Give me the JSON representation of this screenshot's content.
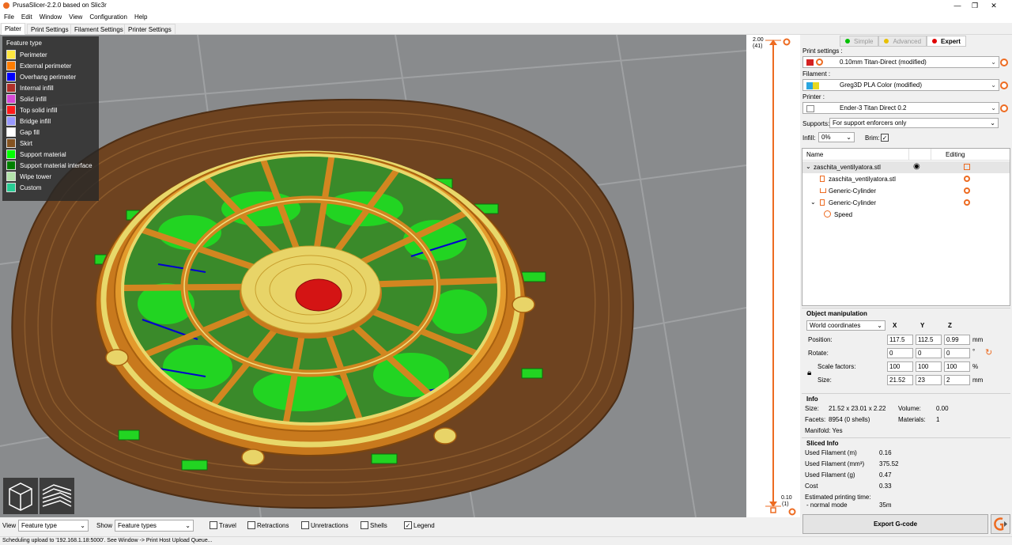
{
  "window": {
    "title": "PrusaSlicer-2.2.0 based on Slic3r",
    "minimize": "—",
    "restore": "❐",
    "close": "✕"
  },
  "menu": [
    "File",
    "Edit",
    "Window",
    "View",
    "Configuration",
    "Help"
  ],
  "tabs": [
    "Plater",
    "Print Settings",
    "Filament Settings",
    "Printer Settings"
  ],
  "active_tab": "Plater",
  "legend": {
    "title": "Feature type",
    "items": [
      {
        "label": "Perimeter",
        "color": "#ffe640"
      },
      {
        "label": "External perimeter",
        "color": "#ff7d00"
      },
      {
        "label": "Overhang perimeter",
        "color": "#0000ff"
      },
      {
        "label": "Internal infill",
        "color": "#b03029"
      },
      {
        "label": "Solid infill",
        "color": "#d64ad6"
      },
      {
        "label": "Top solid infill",
        "color": "#ff1a1a"
      },
      {
        "label": "Bridge infill",
        "color": "#9999ff"
      },
      {
        "label": "Gap fill",
        "color": "#ffffff"
      },
      {
        "label": "Skirt",
        "color": "#845321"
      },
      {
        "label": "Support material",
        "color": "#00ff00"
      },
      {
        "label": "Support material interface",
        "color": "#008000"
      },
      {
        "label": "Wipe tower",
        "color": "#b3e3ab"
      },
      {
        "label": "Custom",
        "color": "#28cc94"
      }
    ]
  },
  "layer_slider": {
    "top_value": "2.00",
    "top_layer": "(41)",
    "bottom_value": "0.10",
    "bottom_layer": "(1)"
  },
  "modes": [
    {
      "label": "Simple",
      "color": "#00c000",
      "active": false
    },
    {
      "label": "Advanced",
      "color": "#e8c000",
      "active": false
    },
    {
      "label": "Expert",
      "color": "#e00000",
      "active": true
    }
  ],
  "print_settings": {
    "label": "Print settings :",
    "value": "0.10mm Titan-Direct (modified)"
  },
  "filament": {
    "label": "Filament :",
    "value": "Greg3D PLA Color (modified)"
  },
  "printer": {
    "label": "Printer :",
    "value": "Ender-3 Titan Direct 0.2"
  },
  "supports": {
    "label": "Supports:",
    "value": "For support enforcers only"
  },
  "infill": {
    "label": "Infill:",
    "value": "0%"
  },
  "brim": {
    "label": "Brim:",
    "checked": "✓"
  },
  "object_list": {
    "col_name": "Name",
    "col_editing": "Editing",
    "rows": [
      {
        "name": "zaschita_ventilyatora.stl",
        "expander": "⌄",
        "selected": true
      },
      {
        "name": "zaschita_ventilyatora.stl"
      },
      {
        "name": "Generic-Cylinder"
      },
      {
        "name": "Generic-Cylinder",
        "expander": "⌄"
      },
      {
        "name": "Speed"
      }
    ]
  },
  "object_manipulation": {
    "title": "Object manipulation",
    "coord_system": "World coordinates",
    "axes": [
      "X",
      "Y",
      "Z"
    ],
    "position": {
      "label": "Position:",
      "values": [
        "117.5",
        "112.5",
        "0.99"
      ],
      "unit": "mm"
    },
    "rotate": {
      "label": "Rotate:",
      "values": [
        "0",
        "0",
        "0"
      ],
      "unit": "°"
    },
    "scale": {
      "label": "Scale factors:",
      "values": [
        "100",
        "100",
        "100"
      ],
      "unit": "%"
    },
    "size": {
      "label": "Size:",
      "values": [
        "21.52",
        "23",
        "2"
      ],
      "unit": "mm"
    }
  },
  "info": {
    "title": "Info",
    "size_label": "Size:",
    "size_value": "21.52 x 23.01 x 2.22",
    "volume_label": "Volume:",
    "volume_value": "0.00",
    "facets_label": "Facets:",
    "facets_value": "8954 (0 shells)",
    "materials_label": "Materials:",
    "materials_value": "1",
    "manifold": "Manifold: Yes"
  },
  "sliced_info": {
    "title": "Sliced Info",
    "rows": [
      {
        "label": "Used Filament (m)",
        "value": "0.16"
      },
      {
        "label": "Used Filament (mm³)",
        "value": "375.52"
      },
      {
        "label": "Used Filament (g)",
        "value": "0.47"
      },
      {
        "label": "Cost",
        "value": "0.33"
      }
    ],
    "time_label": "Estimated printing time:",
    "mode_label": "- normal mode",
    "mode_value": "35m"
  },
  "export_button": "Export G-code",
  "bottom": {
    "view_label": "View",
    "view_value": "Feature type",
    "show_label": "Show",
    "show_value": "Feature types",
    "checks": [
      {
        "label": "Travel",
        "checked": ""
      },
      {
        "label": "Retractions",
        "checked": ""
      },
      {
        "label": "Unretractions",
        "checked": ""
      },
      {
        "label": "Shells",
        "checked": ""
      },
      {
        "label": "Legend",
        "checked": "✓"
      }
    ]
  },
  "status": "Scheduling upload to '192.168.1.18:5000'. See Window -> Print Host Upload Queue..."
}
